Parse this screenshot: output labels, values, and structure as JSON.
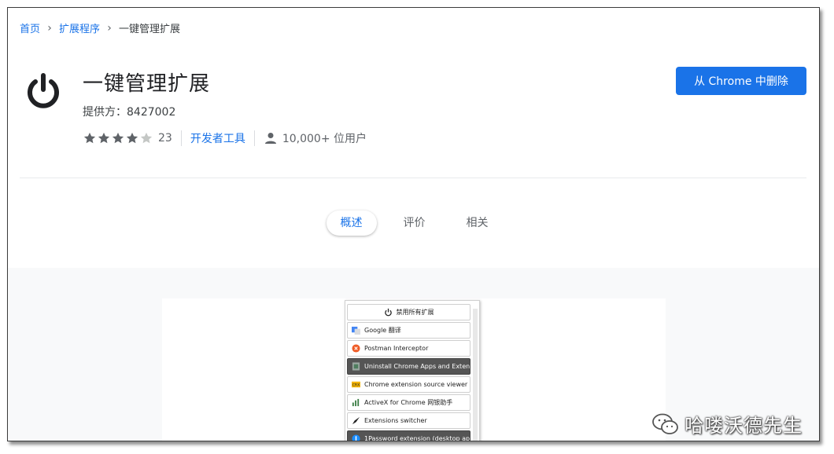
{
  "breadcrumb": {
    "home": "首页",
    "extensions": "扩展程序",
    "current": "一键管理扩展"
  },
  "extension": {
    "title": "一键管理扩展",
    "provider": "提供方：8427002",
    "rating": 4,
    "rating_max": 5,
    "rating_count": "23",
    "category": "开发者工具",
    "users": "10,000+ 位用户"
  },
  "actions": {
    "remove_label": "从 Chrome 中删除"
  },
  "tabs": [
    {
      "label": "概述",
      "active": true
    },
    {
      "label": "评价",
      "active": false
    },
    {
      "label": "相关",
      "active": false
    }
  ],
  "popup": {
    "header": "禁用所有扩展",
    "items": [
      {
        "label": "Google 翻译",
        "icon": "google-translate-icon",
        "selected": false
      },
      {
        "label": "Postman Interceptor",
        "icon": "postman-icon",
        "selected": false
      },
      {
        "label": "Uninstall Chrome Apps and Extensions",
        "icon": "trash-icon",
        "selected": true
      },
      {
        "label": "Chrome extension source viewer",
        "icon": "crx-icon",
        "selected": false
      },
      {
        "label": "ActiveX for Chrome 网银助手",
        "icon": "activex-icon",
        "selected": false
      },
      {
        "label": "Extensions switcher",
        "icon": "rocket-icon",
        "selected": false
      },
      {
        "label": "1Password extension (desktop app",
        "icon": "onepassword-icon",
        "selected": true
      }
    ]
  },
  "watermark": {
    "text": "哈喽沃德先生"
  },
  "colors": {
    "accent": "#1a73e8",
    "star": "#5f6368",
    "star_empty": "#c4c7c5"
  }
}
